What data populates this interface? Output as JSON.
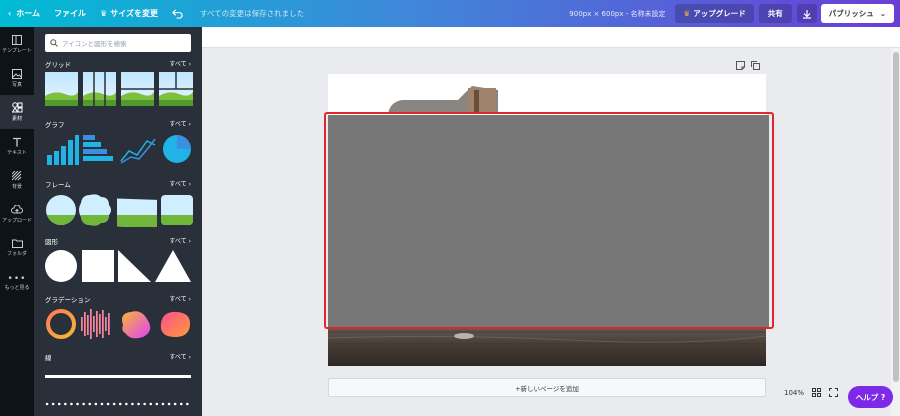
{
  "topbar": {
    "home_label": "ホーム",
    "file_label": "ファイル",
    "resize_label": "サイズを変更",
    "saved_text": "すべての変更は保存されました",
    "size_text": "900px × 600px - 名称未設定",
    "upgrade_label": "アップグレード",
    "share_label": "共有",
    "publish_label": "パブリッシュ",
    "gradient_start": "#00bcd4",
    "gradient_end": "#6a3fd6"
  },
  "leftnav": {
    "items": [
      {
        "label": "テンプレート",
        "icon": "template-icon"
      },
      {
        "label": "写真",
        "icon": "photo-icon"
      },
      {
        "label": "素材",
        "icon": "elements-icon",
        "active": true
      },
      {
        "label": "テキスト",
        "icon": "text-icon"
      },
      {
        "label": "背景",
        "icon": "background-icon"
      },
      {
        "label": "アップロード",
        "icon": "upload-icon"
      },
      {
        "label": "フォルダ",
        "icon": "folder-icon"
      },
      {
        "label": "もっと見る",
        "icon": "more-icon"
      }
    ]
  },
  "panel": {
    "search_placeholder": "アイコンと図形を検索",
    "see_all": "すべて",
    "sections": [
      {
        "title": "グリッド"
      },
      {
        "title": "グラフ"
      },
      {
        "title": "フレーム"
      },
      {
        "title": "図形"
      },
      {
        "title": "グラデーション"
      },
      {
        "title": "線"
      }
    ]
  },
  "canvas": {
    "add_page_label": "+新しいページを追加",
    "zoom": "104%",
    "help_label": "ヘルプ ?",
    "selection_color": "#e3262b",
    "help_color": "#7d2ae8"
  }
}
